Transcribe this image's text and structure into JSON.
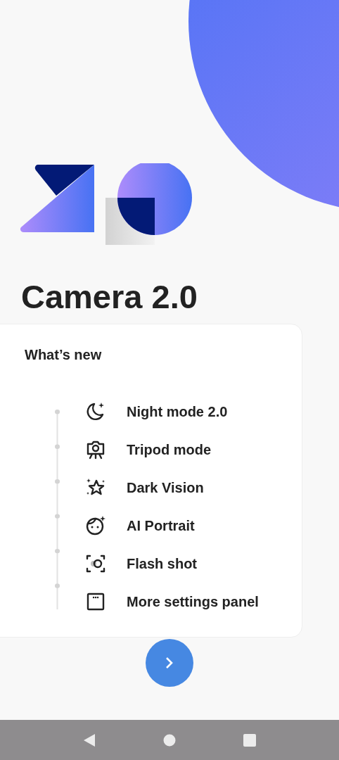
{
  "title": "Camera 2.0",
  "whats_new": {
    "heading": "What’s new",
    "items": [
      {
        "kind": "moon",
        "label": "Night mode 2.0"
      },
      {
        "kind": "tripod",
        "label": "Tripod mode"
      },
      {
        "kind": "stars",
        "label": "Dark Vision"
      },
      {
        "kind": "face",
        "label": "AI Portrait"
      },
      {
        "kind": "flash",
        "label": "Flash shot"
      },
      {
        "kind": "panel",
        "label": "More settings panel"
      }
    ]
  }
}
